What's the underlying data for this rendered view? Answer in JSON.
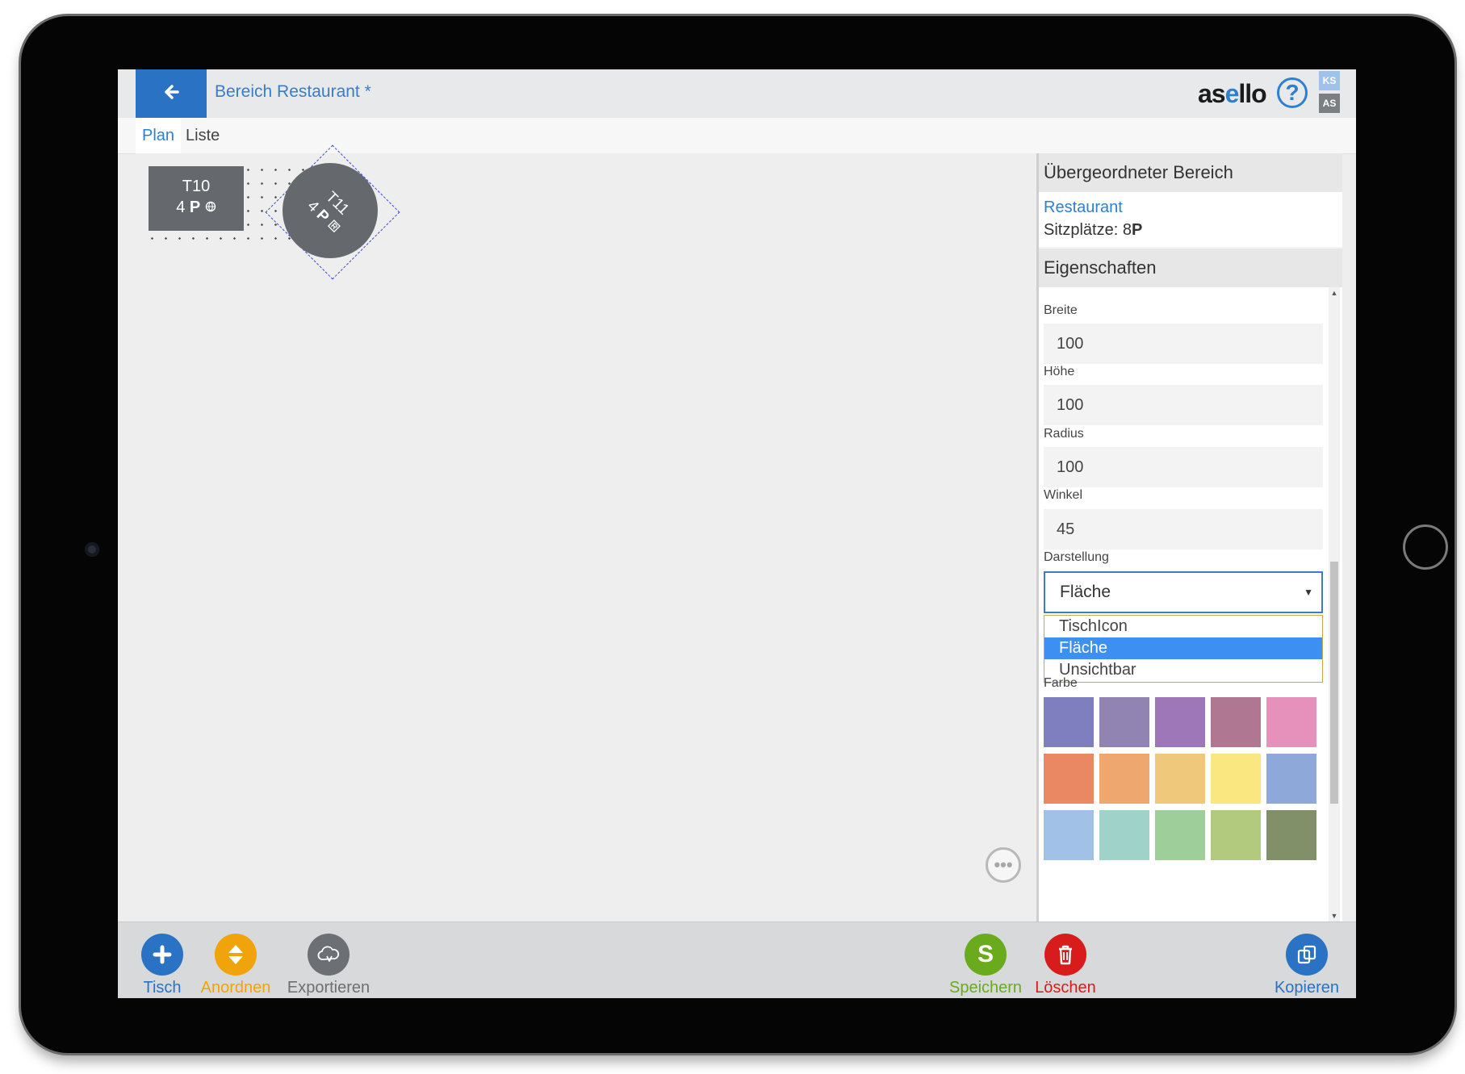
{
  "header": {
    "title": "Bereich Restaurant *",
    "logo_a": "as",
    "logo_e": "e",
    "logo_b": "llo",
    "help": "?",
    "badge_ks": "KS",
    "badge_as": "AS"
  },
  "tabs": [
    {
      "label": "Plan",
      "active": true
    },
    {
      "label": "Liste",
      "active": false
    }
  ],
  "tables": [
    {
      "name": "T10",
      "seats": "4",
      "unit": "P",
      "shape": "rectangle"
    },
    {
      "name": "T11",
      "seats": "4",
      "unit": "P",
      "shape": "circle",
      "angle": 45
    }
  ],
  "panel": {
    "parent_heading": "Übergeordneter Bereich",
    "parent_name": "Restaurant",
    "seats_label": "Sitzplätze: 8",
    "seats_unit": "P",
    "props_heading": "Eigenschaften",
    "fields": [
      {
        "label": "Breite",
        "value": "100"
      },
      {
        "label": "Höhe",
        "value": "100"
      },
      {
        "label": "Radius",
        "value": "100"
      },
      {
        "label": "Winkel",
        "value": "45"
      }
    ],
    "display_label": "Darstellung",
    "display_value": "Fläche",
    "display_options": [
      "TischIcon",
      "Fläche",
      "Unsichtbar"
    ],
    "color_label": "Farbe",
    "colors": [
      "#7f7fbf",
      "#9183b2",
      "#9d77b8",
      "#b07793",
      "#e591bb",
      "#e98862",
      "#eda76f",
      "#f0c87b",
      "#fbe77f",
      "#8fa8da",
      "#a2c1e6",
      "#9fd2c9",
      "#9ecf9b",
      "#b2ca7e",
      "#829069"
    ]
  },
  "toolbar": {
    "tisch": "Tisch",
    "anordnen": "Anordnen",
    "exportieren": "Exportieren",
    "speichern": "Speichern",
    "speichern_icon": "S",
    "loeschen": "Löschen",
    "kopieren": "Kopieren",
    "colors": {
      "blue": "#2a72c4",
      "orange": "#f0a30a",
      "gray": "#6c6f73",
      "green": "#6aab1e",
      "red": "#d81c1c"
    }
  }
}
